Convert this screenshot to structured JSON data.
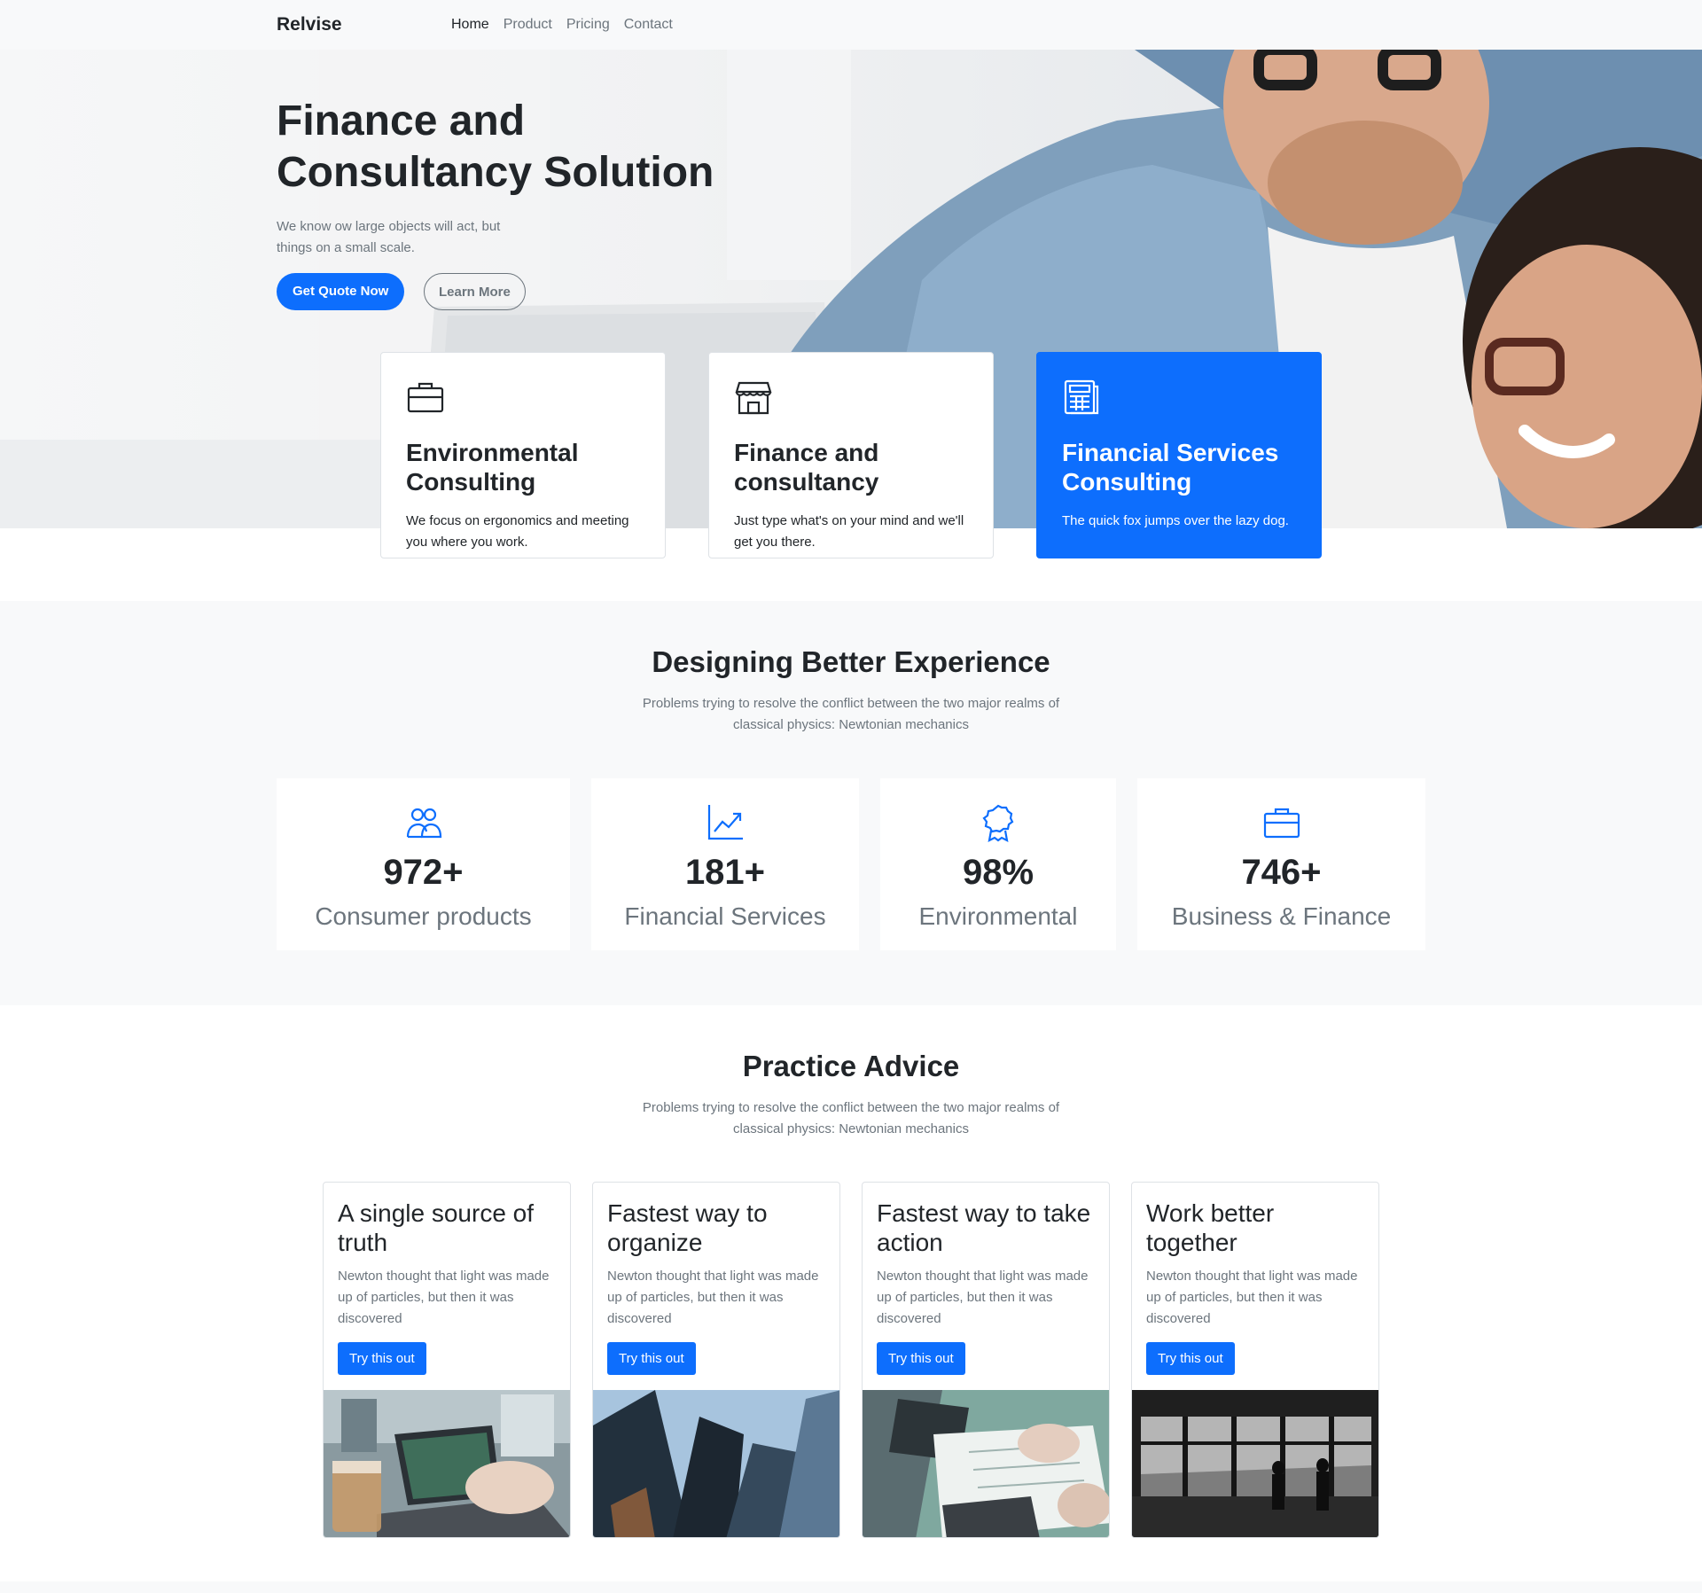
{
  "nav": {
    "brand": "Relvise",
    "links": [
      {
        "label": "Home",
        "active": true
      },
      {
        "label": "Product",
        "active": false
      },
      {
        "label": "Pricing",
        "active": false
      },
      {
        "label": "Contact",
        "active": false
      }
    ]
  },
  "hero": {
    "title": "Finance and Consultancy Solution",
    "subtitle": "We know ow large objects will act, but things on a small scale.",
    "primary_button": "Get Quote Now",
    "secondary_button": "Learn More"
  },
  "features": [
    {
      "icon": "briefcase-icon",
      "title": "Environmental Consulting",
      "text": "We focus on ergonomics and meeting you where you work.",
      "highlight": false
    },
    {
      "icon": "storefront-icon",
      "title": "Finance and consultancy",
      "text": "Just type what's on your mind and we'll get you there.",
      "highlight": false
    },
    {
      "icon": "calculator-icon",
      "title": "Financial Services Consulting",
      "text": "The quick fox jumps over the lazy dog.",
      "highlight": true
    }
  ],
  "stats_section": {
    "title": "Designing Better Experience",
    "subtitle": "Problems trying to resolve the conflict between the two major realms of classical physics: Newtonian mechanics",
    "stats": [
      {
        "icon": "users-icon",
        "value": "972+",
        "label": "Consumer products"
      },
      {
        "icon": "chart-line-icon",
        "value": "181+",
        "label": "Financial Services"
      },
      {
        "icon": "award-icon",
        "value": "98%",
        "label": "Environmental"
      },
      {
        "icon": "briefcase-icon",
        "value": "746+",
        "label": "Business & Finance"
      }
    ]
  },
  "practice_section": {
    "title": "Practice Advice",
    "subtitle": "Problems trying to resolve the conflict between the two major realms of classical physics: Newtonian mechanics",
    "cards": [
      {
        "title": "A single source of truth",
        "text": "Newton thought that light was made up of particles, but then it was discovered",
        "button": "Try this out",
        "image": "laptop-cafe-photo"
      },
      {
        "title": "Fastest way to organize",
        "text": "Newton thought that light was made up of particles, but then it was discovered",
        "button": "Try this out",
        "image": "skyscrapers-photo"
      },
      {
        "title": "Fastest way to take action",
        "text": "Newton thought that light was made up of particles, but then it was discovered",
        "button": "Try this out",
        "image": "desk-paperwork-photo"
      },
      {
        "title": "Work better together",
        "text": "Newton thought that light was made up of particles, but then it was discovered",
        "button": "Try this out",
        "image": "office-window-bw-photo"
      }
    ]
  },
  "colors": {
    "primary": "#0d6efd",
    "text_dark": "#212529",
    "text_muted": "#6c757d",
    "light_bg": "#f8f9fa"
  }
}
